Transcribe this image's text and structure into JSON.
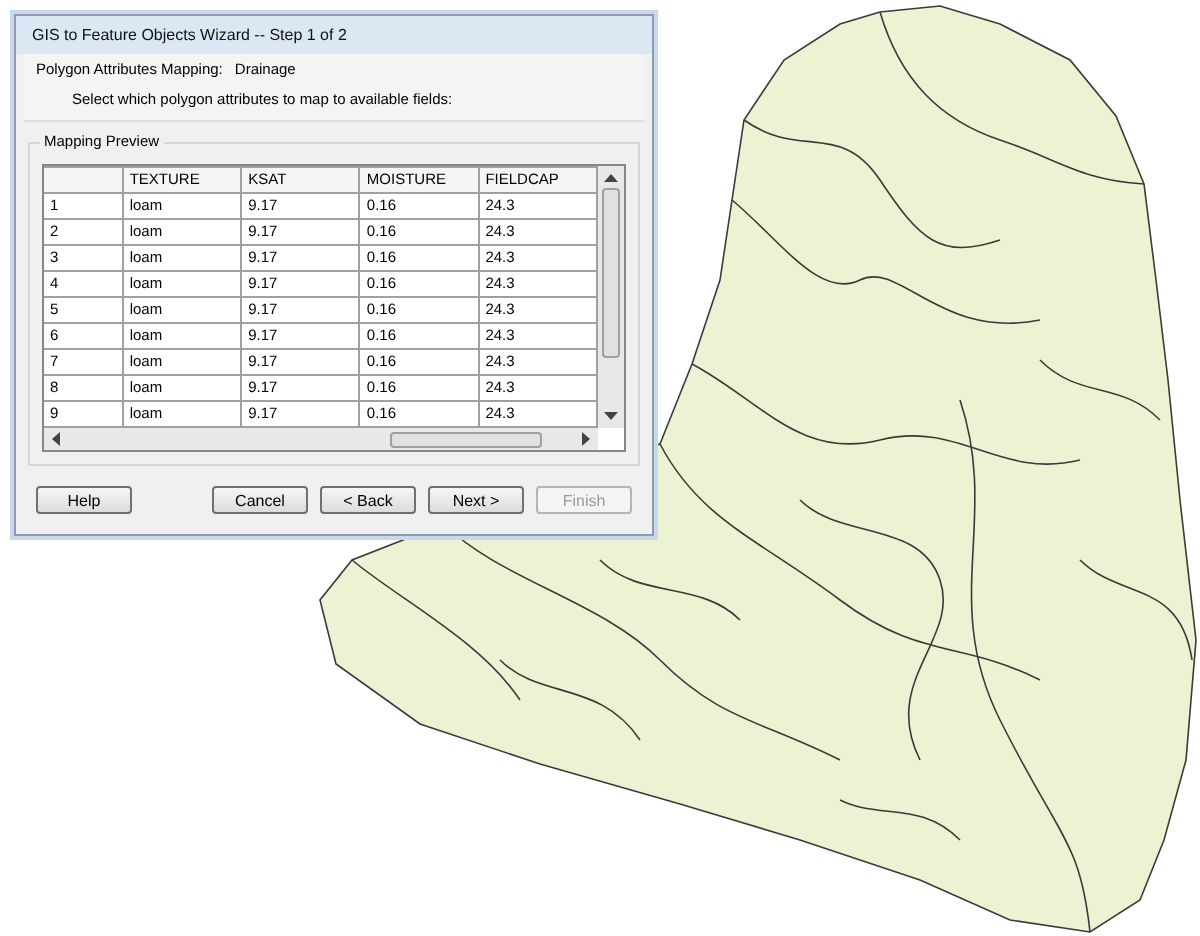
{
  "window": {
    "title": "GIS to Feature Objects Wizard -- Step 1 of 2"
  },
  "header": {
    "mapping_label": "Polygon Attributes Mapping:",
    "mapping_value": "Drainage",
    "instruction": "Select which polygon attributes to map to available fields:"
  },
  "group": {
    "title": "Mapping Preview"
  },
  "table": {
    "columns": [
      "TEXTURE",
      "KSAT",
      "MOISTURE",
      "FIELDCAP"
    ],
    "rows": [
      {
        "number": "1",
        "cells": [
          "loam",
          "9.17",
          "0.16",
          "24.3"
        ]
      },
      {
        "number": "2",
        "cells": [
          "loam",
          "9.17",
          "0.16",
          "24.3"
        ]
      },
      {
        "number": "3",
        "cells": [
          "loam",
          "9.17",
          "0.16",
          "24.3"
        ]
      },
      {
        "number": "4",
        "cells": [
          "loam",
          "9.17",
          "0.16",
          "24.3"
        ]
      },
      {
        "number": "5",
        "cells": [
          "loam",
          "9.17",
          "0.16",
          "24.3"
        ]
      },
      {
        "number": "6",
        "cells": [
          "loam",
          "9.17",
          "0.16",
          "24.3"
        ]
      },
      {
        "number": "7",
        "cells": [
          "loam",
          "9.17",
          "0.16",
          "24.3"
        ]
      },
      {
        "number": "8",
        "cells": [
          "loam",
          "9.17",
          "0.16",
          "24.3"
        ]
      },
      {
        "number": "9",
        "cells": [
          "loam",
          "9.17",
          "0.16",
          "24.3"
        ]
      }
    ]
  },
  "buttons": [
    {
      "label": "Help",
      "disabled": false
    },
    {
      "label": "Cancel",
      "disabled": false
    },
    {
      "label": "< Back",
      "disabled": false
    },
    {
      "label": "Next >",
      "disabled": false
    },
    {
      "label": "Finish",
      "disabled": true
    }
  ]
}
